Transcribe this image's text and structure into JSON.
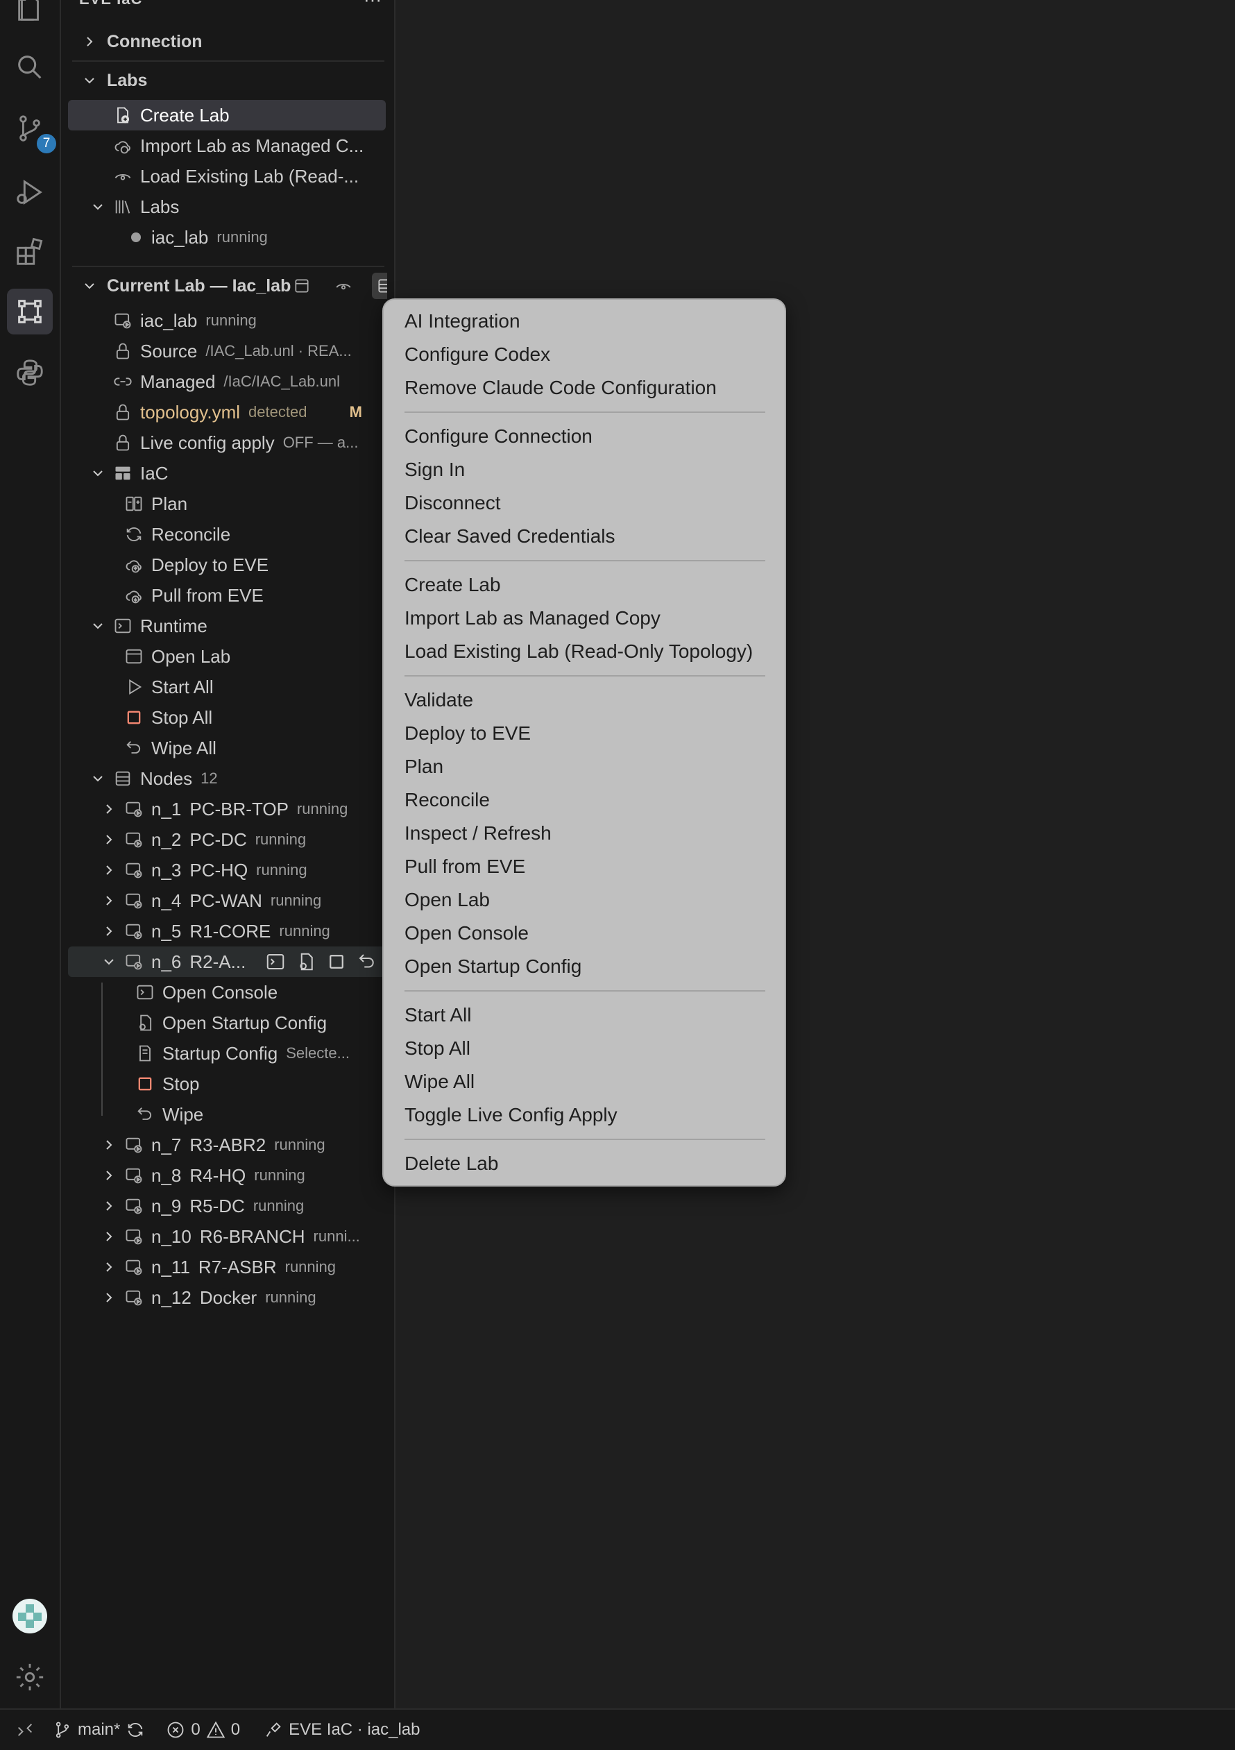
{
  "sidebar": {
    "title": "EVE IaC",
    "more": "···",
    "sections": {
      "connection": "Connection",
      "labs": "Labs",
      "current": "Current Lab — Iac_lab"
    },
    "labs_actions": {
      "create": "Create Lab",
      "import": "Import Lab as Managed C...",
      "load": "Load Existing Lab (Read-..."
    },
    "labs_group": {
      "label": "Labs",
      "item_label": "iac_lab",
      "item_status": "running"
    },
    "current": {
      "lab": {
        "label": "iac_lab",
        "desc": "running"
      },
      "source": {
        "label": "Source",
        "desc": "/IAC_Lab.unl · REA..."
      },
      "managed": {
        "label": "Managed",
        "desc": "/IaC/IAC_Lab.unl"
      },
      "topology": {
        "label": "topology.yml",
        "desc": "detected",
        "flag": "M"
      },
      "live": {
        "label": "Live config apply",
        "desc": "OFF — a..."
      },
      "iac": {
        "label": "IaC",
        "items": [
          "Plan",
          "Reconcile",
          "Deploy to EVE",
          "Pull from EVE"
        ]
      },
      "runtime": {
        "label": "Runtime",
        "items": [
          "Open Lab",
          "Start All",
          "Stop All",
          "Wipe All"
        ]
      },
      "nodes": {
        "label": "Nodes",
        "count": "12",
        "list": [
          {
            "id": "n_1",
            "name": "PC-BR-TOP",
            "status": "running"
          },
          {
            "id": "n_2",
            "name": "PC-DC",
            "status": "running"
          },
          {
            "id": "n_3",
            "name": "PC-HQ",
            "status": "running"
          },
          {
            "id": "n_4",
            "name": "PC-WAN",
            "status": "running"
          },
          {
            "id": "n_5",
            "name": "R1-CORE",
            "status": "running"
          },
          {
            "id": "n_6",
            "name": "R2-A...",
            "status": ""
          },
          {
            "id": "n_7",
            "name": "R3-ABR2",
            "status": "running"
          },
          {
            "id": "n_8",
            "name": "R4-HQ",
            "status": "running"
          },
          {
            "id": "n_9",
            "name": "R5-DC",
            "status": "running"
          },
          {
            "id": "n_10",
            "name": "R6-BRANCH",
            "status": "runni..."
          },
          {
            "id": "n_11",
            "name": "R7-ASBR",
            "status": "running"
          },
          {
            "id": "n_12",
            "name": "Docker",
            "status": "running"
          }
        ],
        "expanded_children": {
          "open_console": "Open Console",
          "open_startup": "Open Startup Config",
          "startup_config": "Startup Config",
          "startup_config_desc": "Selecte...",
          "stop": "Stop",
          "wipe": "Wipe"
        }
      }
    }
  },
  "activity_bar": {
    "source_control_badge": "7",
    "icons": [
      "explorer-icon",
      "search-icon",
      "source-control-icon",
      "run-debug-icon",
      "extensions-icon",
      "eve-iac-icon",
      "python-icon",
      "account-icon",
      "settings-gear-icon"
    ]
  },
  "context_menu": {
    "groups": [
      [
        "AI Integration",
        "Configure Codex",
        "Remove Claude Code Configuration"
      ],
      [
        "Configure Connection",
        "Sign In",
        "Disconnect",
        "Clear Saved Credentials"
      ],
      [
        "Create Lab",
        "Import Lab as Managed Copy",
        "Load Existing Lab (Read-Only Topology)"
      ],
      [
        "Validate",
        "Deploy to EVE",
        "Plan",
        "Reconcile",
        "Inspect / Refresh",
        "Pull from EVE",
        "Open Lab",
        "Open Console",
        "Open Startup Config"
      ],
      [
        "Start All",
        "Stop All",
        "Wipe All",
        "Toggle Live Config Apply"
      ],
      [
        "Delete Lab"
      ]
    ]
  },
  "status_bar": {
    "branch": "main*",
    "errors": "0",
    "warnings": "0",
    "extension": "EVE IaC · iac_lab"
  },
  "colors": {
    "stop_accent": "#f48771",
    "modified": "#e2c08d",
    "badge": "#2c7ab8",
    "menu_bg": "#c0c0c0"
  }
}
